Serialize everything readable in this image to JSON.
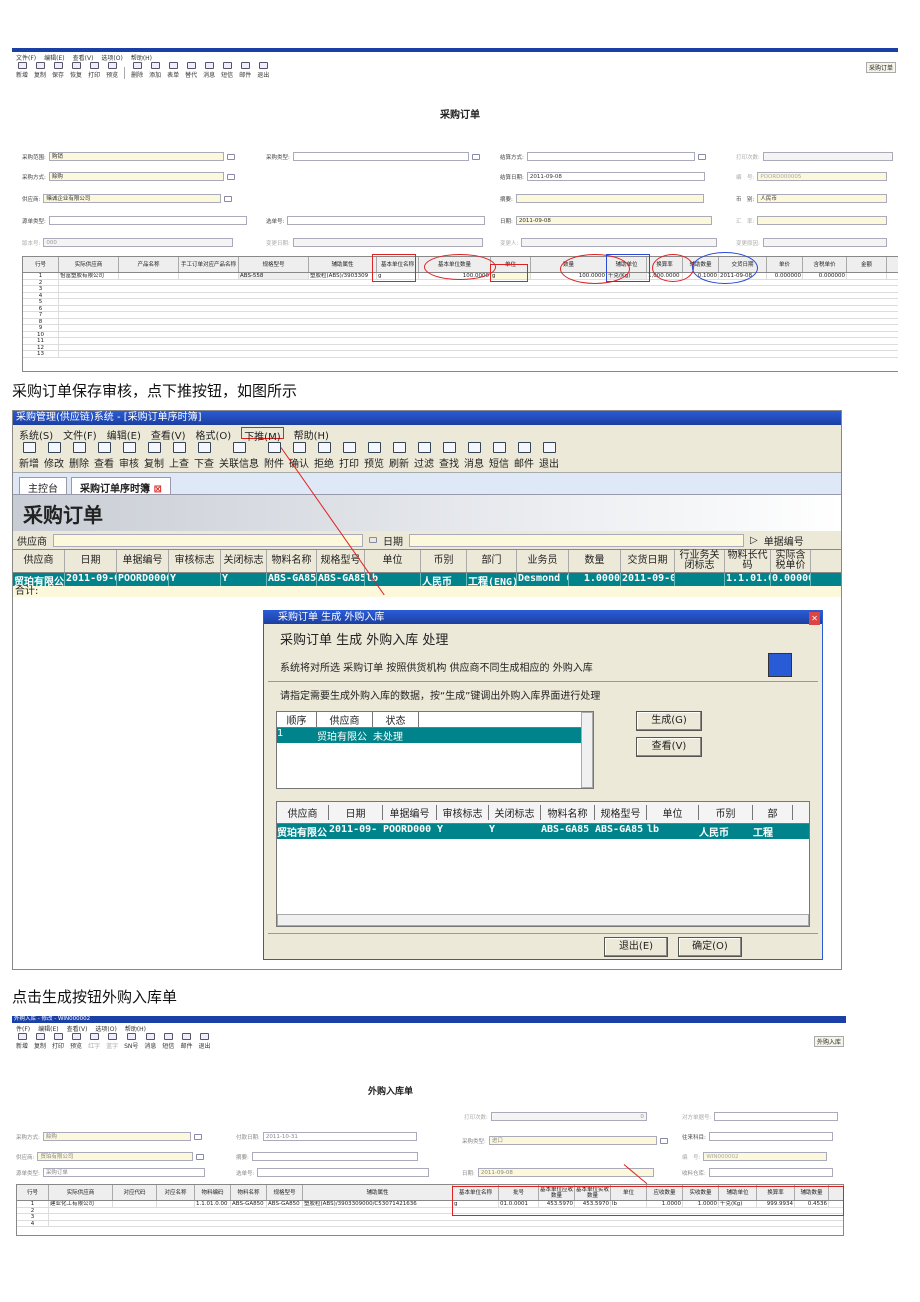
{
  "shot1": {
    "menu": [
      "文件(F)",
      "编辑(E)",
      "查看(V)",
      "选项(O)",
      "帮助(H)"
    ],
    "tools": [
      "新增",
      "复制",
      "保存",
      "恢复",
      "打印",
      "预览",
      "删除",
      "添加",
      "表单",
      "替代",
      "消息",
      "短信",
      "邮件",
      "退出"
    ],
    "badge": "采购订单",
    "title": "采购订单",
    "fields": {
      "cgfw_label": "采购范围:",
      "cgfw": "购销",
      "cglx_label": "采购类型:",
      "cglx": "",
      "jsfs_label": "结算方式:",
      "jsfs": "",
      "dycs_label": "打印次数:",
      "dycs": "",
      "cgfs_label": "采购方式:",
      "cgfs": "赊购",
      "jsrq_label": "结算日期:",
      "jsrq": "2011-09-08",
      "bh_label": "编　号:",
      "bh": "POORD000005",
      "gys_label": "供应商:",
      "gys": "赌诚企业有限公司",
      "zy_label": "摘要:",
      "zy": "",
      "bb_label": "币　别:",
      "bb": "人民币",
      "ydlx_label": "源单类型:",
      "ydlx": "",
      "xdh_label": "选单号:",
      "xdh": "",
      "rq_label": "日期:",
      "rq": "2011-09-08",
      "hl_label": "汇　率:",
      "hl": "",
      "bbh_label": "版本号:",
      "bbh": "000",
      "bgrq_label": "变更日期:",
      "bgrq": "",
      "bgr_label": "变更人:",
      "bgr": "",
      "bgyy_label": "变更原因:",
      "bgyy": ""
    },
    "grid_headers": [
      "行号",
      "实际供应商",
      "产品名称",
      "手工订单对应产品名称",
      "规格型号",
      "辅助属性",
      "基本单位名称",
      "基本单位数量",
      "单位",
      "数量",
      "辅助单位",
      "换算率",
      "辅助数量",
      "交货日期",
      "单价",
      "含税单价",
      "金额"
    ],
    "grid_row": [
      "1",
      "怡富塑胶有限公司",
      "",
      "",
      "ABS-558",
      "塑胶粒(ABS)/3903309",
      "g",
      "100.0000",
      "g",
      "100.0000",
      "千克(Kg)",
      "1,000.0000",
      "0.1000",
      "2011-09-08",
      "0.000000",
      "0.000000",
      ""
    ],
    "row_numbers": [
      "1",
      "2",
      "3",
      "4",
      "5",
      "6",
      "7",
      "8",
      "9",
      "10",
      "11",
      "12",
      "13"
    ]
  },
  "caption1": "采购订单保存审核，点下推按钮，如图所示",
  "shot2": {
    "window_title": "采购管理(供应链)系统 - [采购订单序时簿]",
    "menu": [
      "系统(S)",
      "文件(F)",
      "编辑(E)",
      "查看(V)",
      "格式(O)",
      "下推(M)",
      "帮助(H)"
    ],
    "tools": [
      "新增",
      "修改",
      "删除",
      "查看",
      "审核",
      "复制",
      "上查",
      "下查",
      "关联信息",
      "附件",
      "确认",
      "拒绝",
      "打印",
      "预览",
      "刷新",
      "过滤",
      "查找",
      "消息",
      "短信",
      "邮件",
      "退出"
    ],
    "tab_home": "主控台",
    "tab_active": "采购订单序时簿",
    "banner": "采购订单",
    "supplier_label": "供应商",
    "date_label": "日期",
    "billno_label": "单据编号",
    "headers": [
      "供应商",
      "日期",
      "单据编号",
      "审核标志",
      "关闭标志",
      "物料名称",
      "规格型号",
      "单位",
      "币别",
      "部门",
      "业务员",
      "数量",
      "交货日期",
      "行业务关闭标志",
      "物料长代码",
      "实际含税单价"
    ],
    "row": [
      "贸珀有限公",
      "2011-09-0",
      "POORD0000",
      "Y",
      "Y",
      "ABS-GA850",
      "ABS-GA85",
      "lb",
      "人民币",
      "工程(ENG)",
      "Desmond C",
      "1.0000",
      "2011-09-0",
      "",
      "1.1.01.0.",
      "0.000000"
    ],
    "total_label": "合计:",
    "dialog": {
      "title": "采购订单 生成 外购入库",
      "heading": "采购订单 生成 外购入库 处理",
      "desc": "系统将对所选 采购订单 按照供货机构 供应商不同生成相应的 外购入库",
      "instr": "请指定需要生成外购入库的数据，按“生成”键调出外购入库界面进行处理",
      "list_headers": [
        "顺序",
        "供应商",
        "状态"
      ],
      "list_row": [
        "1",
        "贸珀有限公",
        "未处理"
      ],
      "btn_generate": "生成(G)",
      "btn_view": "查看(V)",
      "detail_headers": [
        "供应商",
        "日期",
        "单据编号",
        "审核标志",
        "关闭标志",
        "物料名称",
        "规格型号",
        "单位",
        "币别",
        "部"
      ],
      "detail_row": [
        "贸珀有限公",
        "2011-09-",
        "POORD000",
        "Y",
        "Y",
        "ABS-GA85",
        "ABS-GA85",
        "lb",
        "人民币",
        "工程"
      ],
      "btn_exit": "退出(E)",
      "btn_ok": "确定(O)"
    }
  },
  "caption2": "点击生成按钮外购入库单",
  "shot3": {
    "window_title": "外购入库 - 修改 - WIN000002",
    "menu": [
      "件(F)",
      "编辑(E)",
      "查看(V)",
      "选项(O)",
      "帮助(H)"
    ],
    "tools": [
      "新增",
      "复制",
      "打印",
      "预览",
      "红字",
      "蓝字",
      "SN号",
      "消息",
      "短信",
      "邮件",
      "退出"
    ],
    "badge": "外购入库",
    "title": "外购入库单",
    "fields": {
      "dycs_label": "打印次数:",
      "dycs": "0",
      "dfdjh_label": "对方单据号:",
      "dfdjh": "",
      "cgfs_label": "采购方式:",
      "cgfs": "赊购",
      "fkrq_label": "付款日期:",
      "fkrq": "2011-10-31",
      "cglx_label": "采购类型:",
      "cglx": "进口",
      "wlkm_label": "往来科目:",
      "wlkm": "",
      "gys_label": "供应商:",
      "gys": "贸珀有限公司",
      "zy_label": "摘要:",
      "zy": "",
      "bh_label": "编　号:",
      "bh": "WIN000002",
      "ydlx_label": "源单类型:",
      "ydlx": "采购订单",
      "xdh_label": "选单号:",
      "xdh": "",
      "rq_label": "日期:",
      "rq": "2011-09-08",
      "slck_label": "收料仓库:",
      "slck": ""
    },
    "grid_headers": [
      "行号",
      "实际供应商",
      "对应代码",
      "对应名称",
      "物料编码",
      "物料名称",
      "规格型号",
      "辅助属性",
      "基本单位名称",
      "批号",
      "基本单位应收数量",
      "基本单位实收数量",
      "单位",
      "应收数量",
      "实收数量",
      "辅助单位",
      "换算率",
      "辅助数量"
    ],
    "grid_row": [
      "1",
      "建业化工有限公司",
      "",
      "",
      "1.1.01.0.00",
      "ABS-GA850",
      "ABS-GA850",
      "塑胶粒(ABS)/3903309000/C53071421636",
      "g",
      "01.0.0001",
      "453.5970",
      "453.5970",
      "lb",
      "1.0000",
      "1.0000",
      "千克(Kg)",
      "999.9934",
      "0.4536"
    ],
    "row_numbers": [
      "1",
      "2",
      "3",
      "4"
    ]
  }
}
